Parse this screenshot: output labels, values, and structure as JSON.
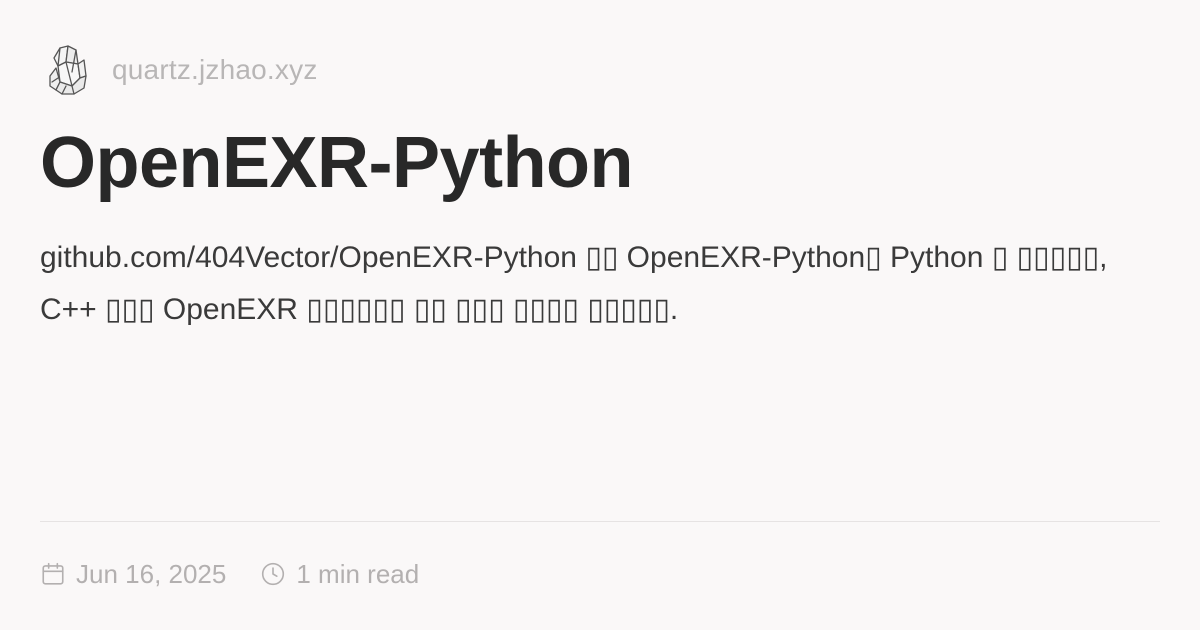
{
  "header": {
    "logo_icon": "crystal-logo-icon",
    "site_name": "quartz.jzhao.xyz"
  },
  "article": {
    "title": "OpenEXR-Python",
    "description": "github.com/404Vector/OpenEXR-Python ▯▯ OpenEXR-Python▯ Python ▯ ▯▯▯▯▯, C++ ▯▯▯ OpenEXR ▯▯▯▯▯▯ ▯▯ ▯▯▯ ▯▯▯▯ ▯▯▯▯▯."
  },
  "meta": {
    "date_icon": "calendar-icon",
    "date": "Jun 16, 2025",
    "read_icon": "clock-icon",
    "read_time": "1 min read"
  },
  "colors": {
    "background": "#faf8f8",
    "title": "#282828",
    "muted": "#b3b0b0"
  }
}
